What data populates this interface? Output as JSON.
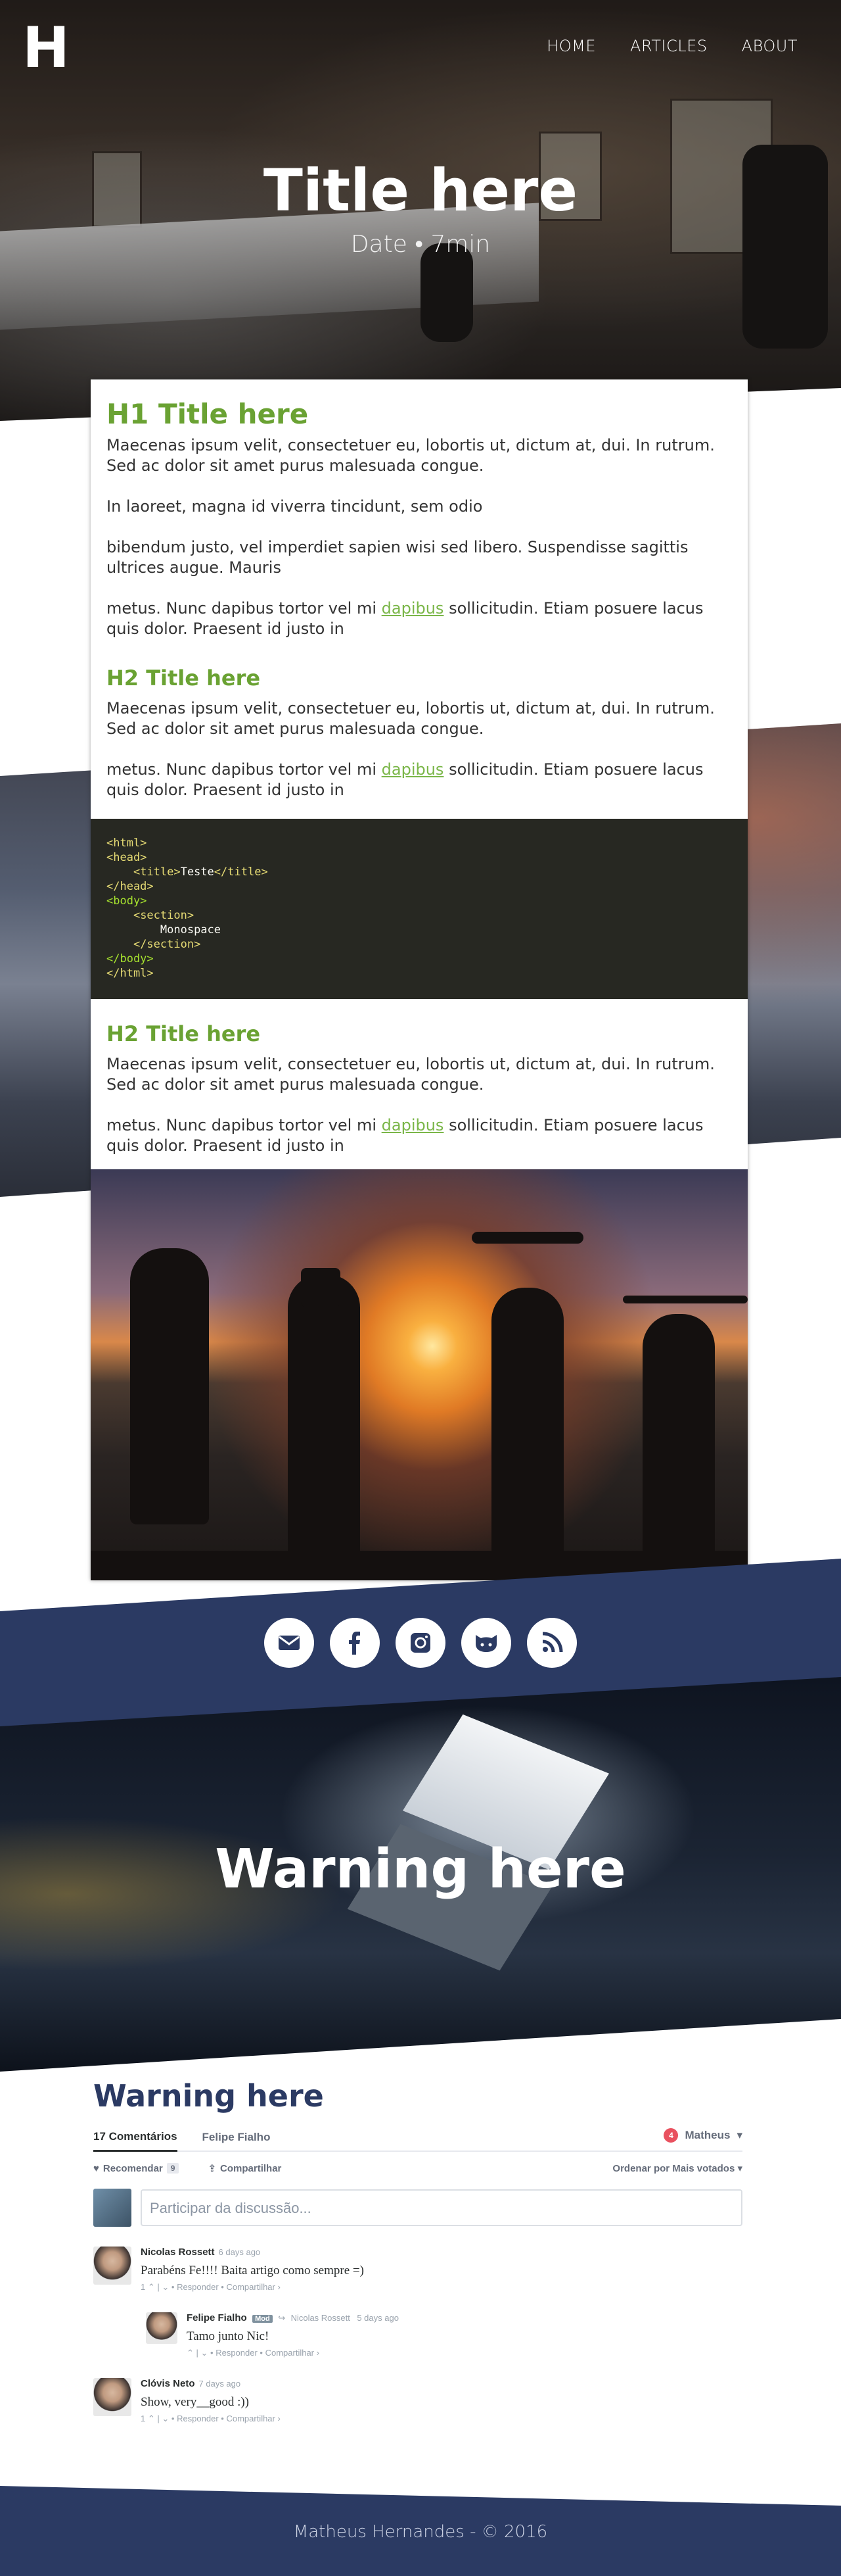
{
  "header": {
    "logo": "H",
    "nav": [
      "HOME",
      "ARTICLES",
      "ABOUT"
    ],
    "title": "Title here",
    "meta": "Date • 7min"
  },
  "article": {
    "h1": "H1 Title here",
    "intro": [
      "Maecenas ipsum velit, consectetuer eu, lobortis ut, dictum at, dui. In rutrum. Sed ac dolor sit amet purus malesuada congue.",
      "In laoreet, magna id viverra tincidunt, sem odio",
      "bibendum justo, vel imperdiet sapien wisi sed libero. Suspendisse sagittis ultrices augue. Mauris"
    ],
    "link_para": {
      "before": "metus. Nunc dapibus tortor vel mi ",
      "link": "dapibus",
      "after": " sollicitudin. Etiam posuere lacus quis dolor. Praesent id justo in"
    },
    "section1": {
      "h2": "H2 Title here",
      "text": "Maecenas ipsum velit, consectetuer eu, lobortis ut, dictum at, dui. In rutrum. Sed ac dolor sit amet purus malesuada congue."
    },
    "code": {
      "html_open": "<html>",
      "head_open": "<head>",
      "title_open": "<title>",
      "title_text": "Teste",
      "title_close": "</title>",
      "head_close": "</head>",
      "body_open": "<body>",
      "section_open": "<section>",
      "section_text": "Monospace",
      "section_close": "</section>",
      "body_close": "</body>",
      "html_close": "</html>"
    },
    "section2": {
      "h2": "H2 Title here",
      "text": "Maecenas ipsum velit, consectetuer eu, lobortis ut, dictum at, dui. In rutrum. Sed ac dolor sit amet purus malesuada congue."
    }
  },
  "social": {
    "icons": [
      "mail-icon",
      "facebook-icon",
      "instagram-icon",
      "github-icon",
      "rss-icon"
    ],
    "icon_color": "#2b3a63"
  },
  "warning": {
    "title": "Warning here"
  },
  "comments": {
    "title": "Warning here",
    "tab_count": "17 Comentários",
    "tab_user": "Felipe Fialho",
    "notifications": "4",
    "current_user": "Matheus",
    "recommend": "Recomendar",
    "recommend_count": "9",
    "share": "Compartilhar",
    "sort": "Ordenar por Mais votados",
    "placeholder": "Participar da discussão...",
    "items": [
      {
        "author": "Nicolas Rossett",
        "time": "6 days ago",
        "text": "Parabéns Fe!!!! Baita artigo como sempre =)",
        "votes": "1",
        "reply": "Responder",
        "share": "Compartilhar ›"
      },
      {
        "author": "Felipe Fialho",
        "badge": "Mod",
        "reply_to": "Nicolas Rossett",
        "time": "5 days ago",
        "text": "Tamo junto Nic!",
        "reply": "Responder",
        "share": "Compartilhar ›"
      },
      {
        "author": "Clóvis Neto",
        "time": "7 days ago",
        "text": "Show, very__good :))",
        "votes": "1",
        "reply": "Responder",
        "share": "Compartilhar ›"
      }
    ]
  },
  "footer": {
    "text": "Matheus Hernandes - © 2016"
  },
  "colors": {
    "accent_green": "#6aa233",
    "navy": "#2b3a63"
  }
}
